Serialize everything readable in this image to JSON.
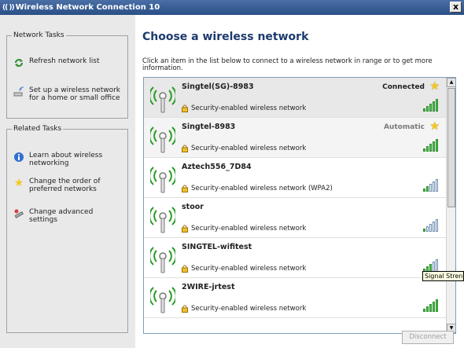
{
  "window": {
    "title": "Wireless Network Connection 10",
    "title_icon": "(( ))",
    "close_label": "x"
  },
  "sidebar": {
    "network_tasks": {
      "title": "Network Tasks",
      "items": [
        {
          "label": "Refresh network list",
          "icon": "refresh-icon"
        },
        {
          "label": "Set up a wireless network for a home or small office",
          "icon": "wireless-setup-icon"
        }
      ]
    },
    "related_tasks": {
      "title": "Related Tasks",
      "items": [
        {
          "label": "Learn about wireless networking",
          "icon": "info-icon"
        },
        {
          "label": "Change the order of preferred networks",
          "icon": "star-icon"
        },
        {
          "label": "Change advanced settings",
          "icon": "settings-icon"
        }
      ]
    }
  },
  "main": {
    "heading": "Choose a wireless network",
    "instructions": "Click an item in the list below to connect to a wireless network in range or to get more information."
  },
  "networks": [
    {
      "ssid": "Singtel(SG)-8983",
      "security": "Security-enabled wireless network",
      "status": "Connected",
      "preferred": true,
      "signal_bars": 5
    },
    {
      "ssid": "Singtel-8983",
      "security": "Security-enabled wireless network",
      "status": "Automatic",
      "preferred": true,
      "signal_bars": 5
    },
    {
      "ssid": "Aztech556_7D84",
      "security": "Security-enabled wireless network (WPA2)",
      "status": "",
      "preferred": false,
      "signal_bars": 2
    },
    {
      "ssid": "stoor",
      "security": "Security-enabled wireless network",
      "status": "",
      "preferred": false,
      "signal_bars": 1
    },
    {
      "ssid": "SINGTEL-wifitest",
      "security": "Security-enabled wireless network",
      "status": "",
      "preferred": false,
      "signal_bars": 3
    },
    {
      "ssid": "2WIRE-jrtest",
      "security": "Security-enabled wireless network",
      "status": "",
      "preferred": false,
      "signal_bars": 5
    }
  ],
  "tooltip": "Signal Strength",
  "buttons": {
    "disconnect": "Disconnect"
  },
  "colors": {
    "heading": "#1c3a6e",
    "titlebar": "#2a4f86",
    "signal": "#4fc04f",
    "star": "#f4c824"
  }
}
